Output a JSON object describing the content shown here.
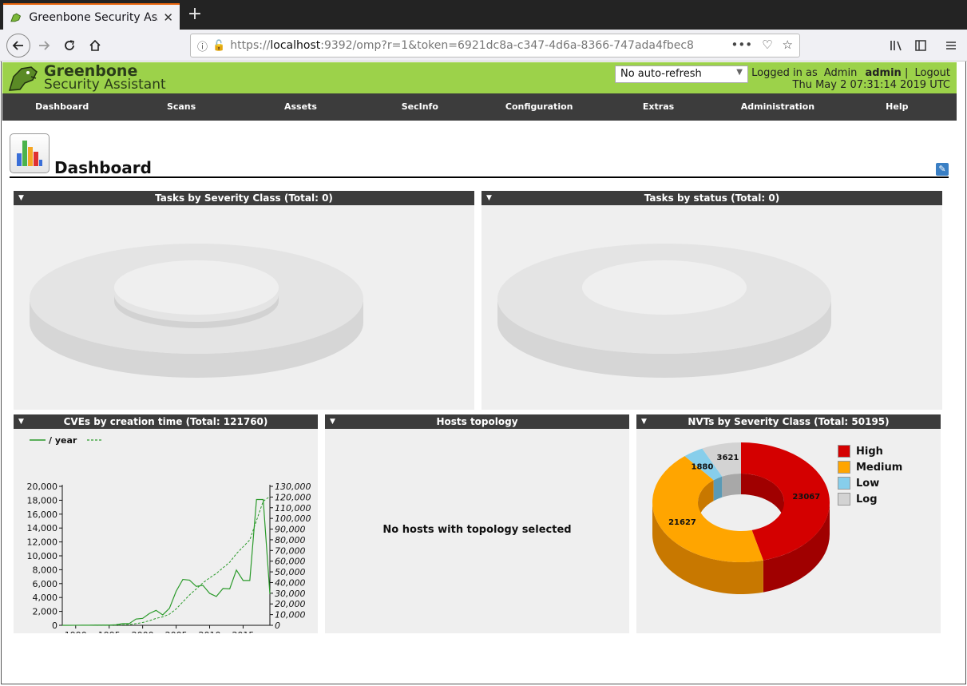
{
  "browser": {
    "tab_title": "Greenbone Security Assistant",
    "tab_close": "✕",
    "new_tab": "+",
    "url_prefix": "https://",
    "url_host": "localhost",
    "url_rest": ":9392/omp?r=1&token=6921dc8a-c347-4d6a-8366-747ada4fbec8",
    "menu_dots": "•••"
  },
  "header": {
    "logo_line1": "Greenbone",
    "logo_line2": "Security Assistant",
    "refresh_selected": "No auto-refresh",
    "logged_in_label": "Logged in as",
    "role": "Admin",
    "username": "admin",
    "separator": "|",
    "logout": "Logout",
    "datetime": "Thu May 2 07:31:14 2019 UTC"
  },
  "nav": [
    "Dashboard",
    "Scans",
    "Assets",
    "SecInfo",
    "Configuration",
    "Extras",
    "Administration",
    "Help"
  ],
  "page": {
    "title": "Dashboard"
  },
  "panels": {
    "tasks_severity": "Tasks by Severity Class (Total: 0)",
    "tasks_status": "Tasks by status (Total: 0)",
    "cves": "CVEs by creation time (Total: 121760)",
    "hosts": "Hosts topology",
    "hosts_empty": "No hosts with topology selected",
    "nvts": "NVTs by Severity Class (Total: 50195)"
  },
  "colors": {
    "high": "#d40000",
    "medium": "#ffa500",
    "low": "#87ceeb",
    "log": "#d3d3d3",
    "line": "#2a9a2a"
  },
  "chart_data": [
    {
      "type": "line",
      "legend": [
        " / year",
        ""
      ],
      "x": [
        1988,
        1989,
        1990,
        1991,
        1992,
        1993,
        1994,
        1995,
        1996,
        1997,
        1998,
        1999,
        2000,
        2001,
        2002,
        2003,
        2004,
        2005,
        2006,
        2007,
        2008,
        2009,
        2010,
        2011,
        2012,
        2013,
        2014,
        2015,
        2016,
        2017,
        2018,
        2019
      ],
      "series": [
        {
          "values": [
            2,
            2,
            10,
            15,
            15,
            25,
            25,
            25,
            75,
            250,
            250,
            900,
            1000,
            1700,
            2150,
            1500,
            2450,
            4900,
            6600,
            6500,
            5600,
            5750,
            4600,
            4150,
            5300,
            5250,
            7950,
            6450,
            6450,
            18100,
            18100,
            4500
          ]
        },
        {
          "values": [
            2,
            4,
            14,
            29,
            44,
            69,
            94,
            119,
            194,
            444,
            694,
            1594,
            2594,
            4294,
            6444,
            7944,
            10394,
            15294,
            21894,
            28394,
            33994,
            39744,
            44344,
            48494,
            53794,
            59044,
            66994,
            73444,
            79894,
            97994,
            116094,
            120594
          ]
        }
      ],
      "yticks_left": [
        "20,000",
        "18,000",
        "16,000",
        "14,000",
        "12,000",
        "10,000",
        "8,000",
        "6,000",
        "4,000",
        "2,000",
        "0"
      ],
      "yticks_right": [
        "130,000",
        "120,000",
        "110,000",
        "100,000",
        "90,000",
        "80,000",
        "70,000",
        "60,000",
        "50,000",
        "40,000",
        "30,000",
        "20,000",
        "10,000",
        "0"
      ],
      "xticks": [
        "1990",
        "1995",
        "2000",
        "2005",
        "2010",
        "2015"
      ],
      "ylim_left": [
        0,
        20000
      ],
      "ylim_right": [
        0,
        130000
      ]
    },
    {
      "type": "pie",
      "categories": [
        "High",
        "Medium",
        "Low",
        "Log"
      ],
      "values": [
        23067,
        21627,
        1880,
        3621
      ],
      "labels": [
        "23067",
        "21627",
        "1880",
        "3621"
      ]
    }
  ]
}
